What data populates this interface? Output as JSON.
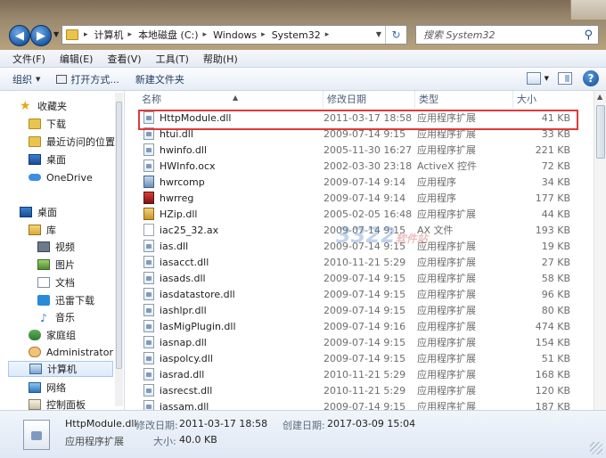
{
  "address": {
    "crumbs": [
      "计算机",
      "本地磁盘 (C:)",
      "Windows",
      "System32"
    ]
  },
  "search": {
    "placeholder": "搜索 System32"
  },
  "menu": [
    "文件(F)",
    "编辑(E)",
    "查看(V)",
    "工具(T)",
    "帮助(H)"
  ],
  "toolbar": {
    "organize": "组织",
    "open_with": "打开方式...",
    "new_folder": "新建文件夹"
  },
  "nav": {
    "favorites": "收藏夹",
    "downloads": "下载",
    "recent": "最近访问的位置",
    "desktop_fav": "桌面",
    "onedrive": "OneDrive",
    "desktop": "桌面",
    "library": "库",
    "videos": "视频",
    "pictures": "图片",
    "documents": "文档",
    "xunlei": "迅雷下载",
    "music": "音乐",
    "homegroup": "家庭组",
    "admin": "Administrator",
    "computer": "计算机",
    "network": "网络",
    "control_panel": "控制面板"
  },
  "columns": {
    "name": "名称",
    "date": "修改日期",
    "type": "类型",
    "size": "大小"
  },
  "files": [
    {
      "name": "HttpModule.dll",
      "date": "2011-03-17 18:58",
      "type": "应用程序扩展",
      "size": "41 KB",
      "icon": "dll"
    },
    {
      "name": "htui.dll",
      "date": "2009-07-14 9:15",
      "type": "应用程序扩展",
      "size": "33 KB",
      "icon": "dll"
    },
    {
      "name": "hwinfo.dll",
      "date": "2005-11-30 16:27",
      "type": "应用程序扩展",
      "size": "221 KB",
      "icon": "dll"
    },
    {
      "name": "HWInfo.ocx",
      "date": "2002-03-30 23:18",
      "type": "ActiveX 控件",
      "size": "72 KB",
      "icon": "dll"
    },
    {
      "name": "hwrcomp",
      "date": "2009-07-14 9:14",
      "type": "应用程序",
      "size": "34 KB",
      "icon": "exe"
    },
    {
      "name": "hwrreg",
      "date": "2009-07-14 9:14",
      "type": "应用程序",
      "size": "177 KB",
      "icon": "reg"
    },
    {
      "name": "HZip.dll",
      "date": "2005-02-05 16:48",
      "type": "应用程序扩展",
      "size": "44 KB",
      "icon": "zip"
    },
    {
      "name": "iac25_32.ax",
      "date": "2009-07-14 9:15",
      "type": "AX 文件",
      "size": "193 KB",
      "icon": "ax"
    },
    {
      "name": "ias.dll",
      "date": "2009-07-14 9:15",
      "type": "应用程序扩展",
      "size": "19 KB",
      "icon": "dll"
    },
    {
      "name": "iasacct.dll",
      "date": "2010-11-21 5:29",
      "type": "应用程序扩展",
      "size": "27 KB",
      "icon": "dll"
    },
    {
      "name": "iasads.dll",
      "date": "2009-07-14 9:15",
      "type": "应用程序扩展",
      "size": "58 KB",
      "icon": "dll"
    },
    {
      "name": "iasdatastore.dll",
      "date": "2009-07-14 9:15",
      "type": "应用程序扩展",
      "size": "96 KB",
      "icon": "dll"
    },
    {
      "name": "iashlpr.dll",
      "date": "2009-07-14 9:15",
      "type": "应用程序扩展",
      "size": "80 KB",
      "icon": "dll"
    },
    {
      "name": "IasMigPlugin.dll",
      "date": "2009-07-14 9:16",
      "type": "应用程序扩展",
      "size": "474 KB",
      "icon": "dll"
    },
    {
      "name": "iasnap.dll",
      "date": "2009-07-14 9:15",
      "type": "应用程序扩展",
      "size": "154 KB",
      "icon": "dll"
    },
    {
      "name": "iaspolcy.dll",
      "date": "2009-07-14 9:15",
      "type": "应用程序扩展",
      "size": "51 KB",
      "icon": "dll"
    },
    {
      "name": "iasrad.dll",
      "date": "2010-11-21 5:29",
      "type": "应用程序扩展",
      "size": "168 KB",
      "icon": "dll"
    },
    {
      "name": "iasrecst.dll",
      "date": "2010-11-21 5:29",
      "type": "应用程序扩展",
      "size": "120 KB",
      "icon": "dll"
    },
    {
      "name": "iassam.dll",
      "date": "2009-07-14 9:15",
      "type": "应用程序扩展",
      "size": "187 KB",
      "icon": "dll"
    }
  ],
  "watermark": {
    "main": "3322",
    "sub": "软件站"
  },
  "details": {
    "name": "HttpModule.dll",
    "type": "应用程序扩展",
    "modified_label": "修改日期:",
    "modified_value": "2011-03-17 18:58",
    "created_label": "创建日期:",
    "created_value": "2017-03-09 15:04",
    "size_label": "大小:",
    "size_value": "40.0 KB"
  }
}
